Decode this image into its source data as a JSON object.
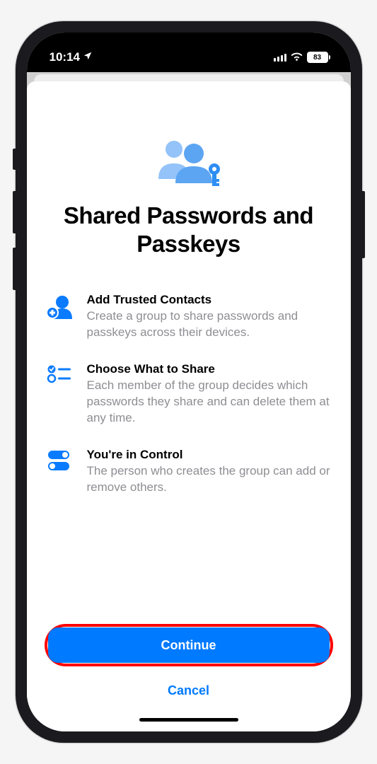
{
  "status_bar": {
    "time": "10:14",
    "battery_percent": "83"
  },
  "page": {
    "title": "Shared Passwords and Passkeys"
  },
  "features": [
    {
      "title": "Add Trusted Contacts",
      "description": "Create a group to share passwords and passkeys across their devices."
    },
    {
      "title": "Choose What to Share",
      "description": "Each member of the group decides which passwords they share and can delete them at any time."
    },
    {
      "title": "You're in Control",
      "description": "The person who creates the group can add or remove others."
    }
  ],
  "buttons": {
    "primary": "Continue",
    "secondary": "Cancel"
  }
}
